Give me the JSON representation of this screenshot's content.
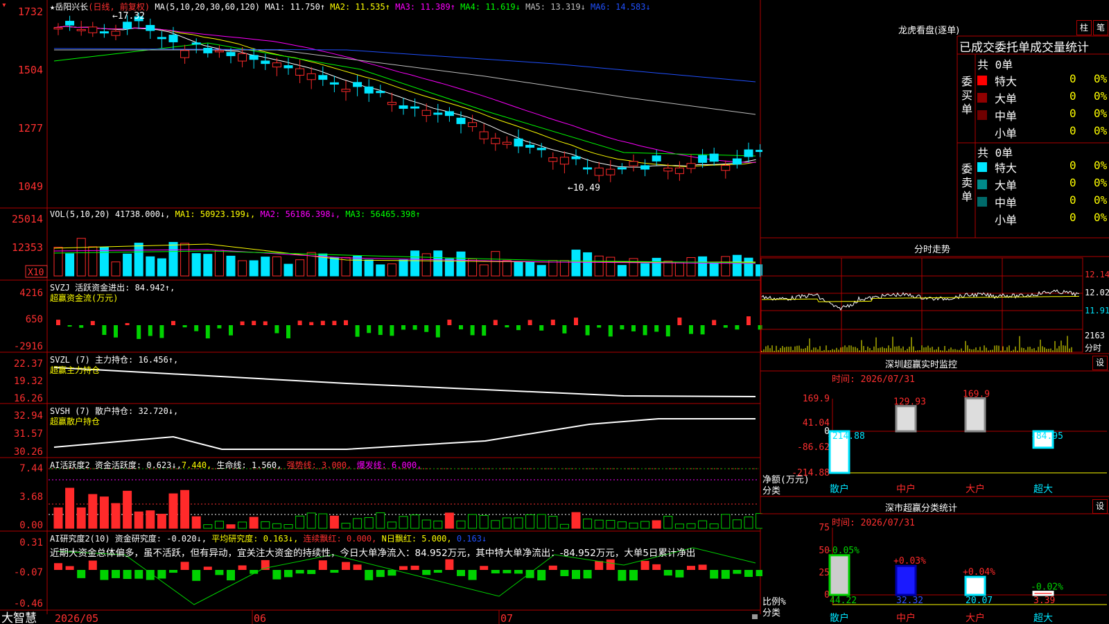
{
  "colors": {
    "up": "#ff2a2a",
    "down": "#00e6ff",
    "accent": "#ffff00",
    "grid": "#b00000",
    "bg": "#000000",
    "green": "#00d200"
  },
  "header": {
    "stock": "岳阳兴长",
    "mode": "(日线, 前复权)",
    "ma_label": "MA(5,10,20,30,60,120)",
    "ma": [
      {
        "label": "MA1: 11.750↑",
        "color": "#ffffff"
      },
      {
        "label": "MA2: 11.535↑",
        "color": "#ffff00"
      },
      {
        "label": "MA3: 11.389↑",
        "color": "#ff00ff"
      },
      {
        "label": "MA4: 11.619↓",
        "color": "#00ff00"
      },
      {
        "label": "MA5: 13.319↓",
        "color": "#c0c0c0"
      },
      {
        "label": "MA6: 14.583↓",
        "color": "#2050ff"
      }
    ],
    "high_mark": "←17.32",
    "low_mark": "←10.49"
  },
  "axes": {
    "price": [
      "1732",
      "1504",
      "1277",
      "1049"
    ],
    "vol": [
      "25014",
      "12353"
    ],
    "vol_unit": "X10",
    "svzj": [
      "4216",
      "650",
      "-2916"
    ],
    "svzl": [
      "22.37",
      "19.32",
      "16.26"
    ],
    "svsh": [
      "32.94",
      "31.57",
      "30.26"
    ],
    "ai": [
      "7.44",
      "3.68",
      "0.00"
    ],
    "ai2": [
      "0.31",
      "-0.07",
      "-0.46"
    ],
    "dates": [
      "2026/05",
      "06",
      "07"
    ]
  },
  "vol": {
    "label": "VOL(5,10,20)",
    "v": "41738.000↓,",
    "ma1": "MA1: 50923.199↓,",
    "ma2": "MA2: 56186.398↓,",
    "ma3": "MA3: 56465.398↑"
  },
  "svzj": {
    "line1": "SVZJ  活跃资金进出: 84.942↑,",
    "line2": "超赢资金流(万元)"
  },
  "svzl": {
    "line1": "SVZL (7) 主力持仓: 16.456↑,",
    "line2": "超赢主力持仓"
  },
  "svsh": {
    "line1": "SVSH (7) 散户持仓: 32.720↓,",
    "line2": "超赢散户持仓"
  },
  "ai": {
    "a": "AI活跃度2 资金活跃度: 0.623↓,",
    "b": "7.440,",
    "c": "生命线: 1.560,",
    "d": "强势线: 3.000,",
    "e": "爆发线: 6.000,"
  },
  "ai2": {
    "a": "AI研究度2(10) 资金研究度: -0.020↓,",
    "b": "平均研究度: 0.163↓,",
    "c": "连续飘红: 0.000,",
    "d": "N日飘红: 5.000,",
    "e": "0.163↓",
    "comment": "近期大资金总体偏多，虽不活跃，但有异动，宜关注大资金的持续性，今日大单净流入：84.952万元，其中特大单净流出：-84.952万元，大单5日累计净出"
  },
  "brand": "大智慧",
  "lhb": {
    "title": "龙虎看盘(逐单)",
    "btn1": "柱",
    "btn2": "笔",
    "tabs": "已成交委托单成交量统计",
    "buy": {
      "side": "委买单",
      "total": "共 0单",
      "rows": [
        {
          "name": "特大",
          "n": "0",
          "p": "0%"
        },
        {
          "name": "大单",
          "n": "0",
          "p": "0%"
        },
        {
          "name": "中单",
          "n": "0",
          "p": "0%"
        },
        {
          "name": "小单",
          "n": "0",
          "p": "0%"
        }
      ]
    },
    "sell": {
      "side": "委卖单",
      "total": "共 0单",
      "rows": [
        {
          "name": "特大",
          "n": "0",
          "p": "0%"
        },
        {
          "name": "大单",
          "n": "0",
          "p": "0%"
        },
        {
          "name": "中单",
          "n": "0",
          "p": "0%"
        },
        {
          "name": "小单",
          "n": "0",
          "p": "0%"
        }
      ]
    }
  },
  "fenshi": {
    "title": "分时走势",
    "y": [
      "12.14",
      "12.02",
      "11.91"
    ],
    "vol_top": "2163",
    "unit": "分时"
  },
  "monitor": {
    "title": "深圳超赢实时监控",
    "btn": "设",
    "time": "时间: 2026/07/31",
    "y": [
      "169.9",
      "41.04",
      "0",
      "-86.62",
      "-214.88"
    ],
    "labels_side": [
      "净额(万元)",
      "分类"
    ],
    "cats": [
      "散户",
      "中户",
      "大户",
      "超大"
    ],
    "values": [
      -214.88,
      129.93,
      169.9,
      -84.95
    ],
    "value_labels": [
      "-214.88",
      "129.93",
      "169.9",
      "-84.95"
    ]
  },
  "stats": {
    "title": "深市超赢分类统计",
    "btn": "设",
    "time": "时间: 2026/07/31",
    "y": [
      "75",
      "50",
      "25",
      "0"
    ],
    "labels_side": [
      "比例%",
      "分类"
    ],
    "cats": [
      "散户",
      "中户",
      "大户",
      "超大"
    ],
    "values": [
      44.22,
      32.32,
      20.07,
      3.39
    ],
    "value_labels": [
      "44.22",
      "32.32",
      "20.07",
      "3.39"
    ],
    "changes": [
      "-0.05%",
      "+0.03%",
      "+0.04%",
      "-0.02%"
    ]
  }
}
